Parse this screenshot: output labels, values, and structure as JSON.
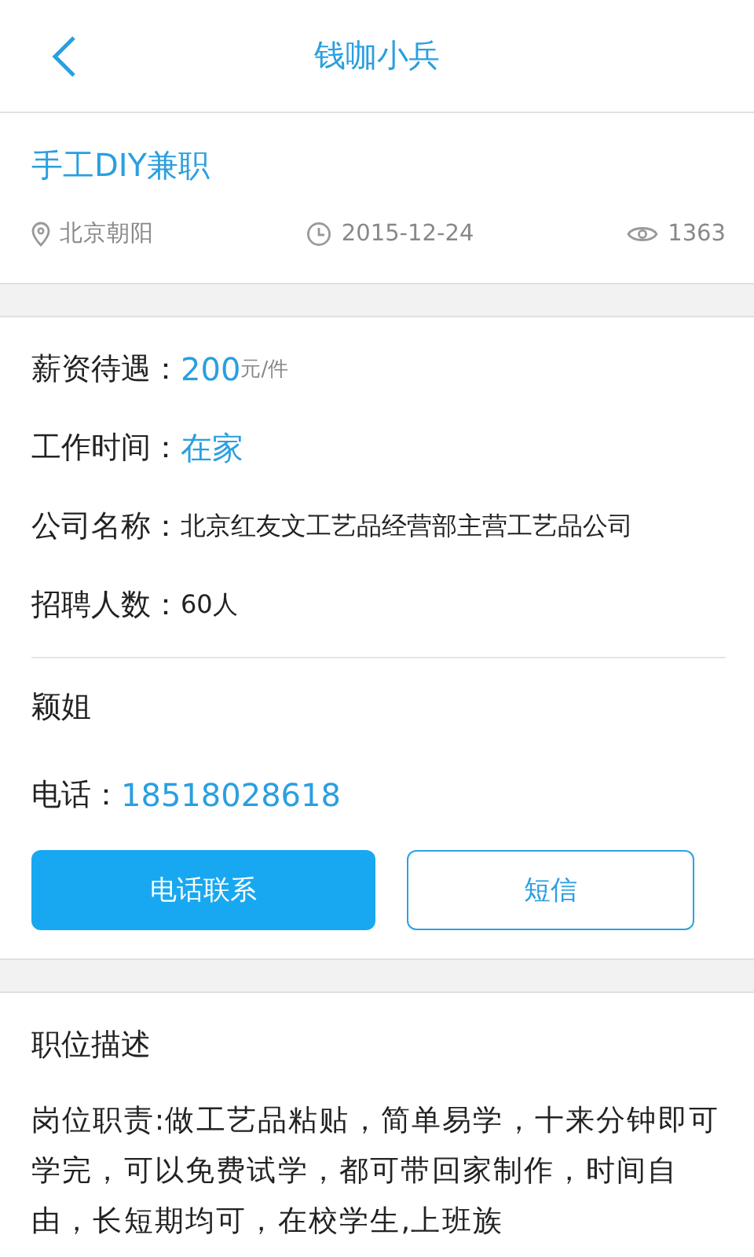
{
  "header": {
    "title": "钱咖小兵"
  },
  "job": {
    "title": "手工DIY兼职",
    "location": "北京朝阳",
    "date": "2015-12-24",
    "views": "1363"
  },
  "details": [
    {
      "kind": "salary",
      "label": "薪资待遇：",
      "value": "200",
      "unit": "元/件"
    },
    {
      "kind": "highlight",
      "label": "工作时间：",
      "value": "在家"
    },
    {
      "kind": "plain",
      "label": "公司名称：",
      "value": "北京红友文工艺品经营部主营工艺品公司"
    },
    {
      "kind": "plain",
      "label": "招聘人数：",
      "value": "60人"
    }
  ],
  "contact": {
    "name": "颖姐",
    "phone_label": "电话：",
    "phone": "18518028618",
    "buttons": [
      {
        "kind": "primary",
        "label": "电话联系"
      },
      {
        "kind": "outline",
        "label": "短信"
      }
    ]
  },
  "description": {
    "heading": "职位描述",
    "text": "岗位职责:做工艺品粘贴，简单易学，十来分钟即可学完，可以免费试学，都可带回家制作，时间自由，长短期均可，在校学生,上班族"
  }
}
